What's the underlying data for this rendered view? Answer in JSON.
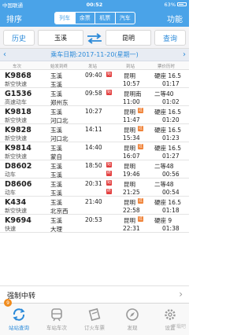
{
  "status": {
    "carrier": "中国联通",
    "time": "00:52",
    "battery": "63%"
  },
  "nav": {
    "left": "排序",
    "right": "功能",
    "segments": [
      "列车",
      "余票",
      "机票",
      "汽车"
    ],
    "active_segment": 0
  },
  "search": {
    "history": "历史",
    "from": "玉溪",
    "to": "昆明",
    "query": "查询"
  },
  "date": {
    "label": "乘车日期:2017-11-20(星期一)"
  },
  "headers": {
    "train": "车次",
    "origin": "始发到终",
    "depart": "发站",
    "arrive": "到站",
    "price": "票价历时"
  },
  "trains": [
    {
      "no": "K9868",
      "type": "新空快速",
      "from": "玉溪",
      "origin": "玉溪",
      "dep": "09:40",
      "fa": true,
      "zhong": false,
      "to": "昆明",
      "arr": "10:57",
      "guo": false,
      "price": "硬座 16.5",
      "dur": "01:17"
    },
    {
      "no": "G1536",
      "type": "高速动车",
      "from": "玉溪",
      "origin": "郑州东",
      "dep": "09:58",
      "fa": true,
      "zhong": false,
      "to": "昆明南",
      "arr": "11:00",
      "guo": false,
      "price": "二等40",
      "dur": "01:02"
    },
    {
      "no": "K9818",
      "type": "新空快速",
      "from": "玉溪",
      "origin": "河口北",
      "dep": "10:27",
      "fa": false,
      "zhong": false,
      "to": "昆明",
      "arr": "11:47",
      "guo": true,
      "price": "硬座 16.5",
      "dur": "01:20"
    },
    {
      "no": "K9828",
      "type": "新空快速",
      "from": "玉溪",
      "origin": "河口北",
      "dep": "14:11",
      "fa": false,
      "zhong": false,
      "to": "昆明",
      "arr": "15:34",
      "guo": true,
      "price": "硬座 16.5",
      "dur": "01:23"
    },
    {
      "no": "K9814",
      "type": "新空快速",
      "from": "玉溪",
      "origin": "蒙自",
      "dep": "14:40",
      "fa": false,
      "zhong": false,
      "to": "昆明",
      "arr": "16:07",
      "guo": true,
      "price": "硬座 16.5",
      "dur": "01:27"
    },
    {
      "no": "D8602",
      "type": "动车",
      "from": "玉溪",
      "origin": "玉溪",
      "dep": "18:50",
      "fa": true,
      "zhong": true,
      "to": "昆明",
      "arr": "19:46",
      "guo": false,
      "price": "二等48",
      "dur": "00:56"
    },
    {
      "no": "D8606",
      "type": "动车",
      "from": "玉溪",
      "origin": "玉溪",
      "dep": "20:31",
      "fa": true,
      "zhong": true,
      "to": "昆明",
      "arr": "21:25",
      "guo": false,
      "price": "二等48",
      "dur": "00:54"
    },
    {
      "no": "K434",
      "type": "新空快速",
      "from": "玉溪",
      "origin": "北京西",
      "dep": "21:40",
      "fa": false,
      "zhong": false,
      "to": "昆明",
      "arr": "22:58",
      "guo": true,
      "price": "硬座 16.5",
      "dur": "01:18"
    },
    {
      "no": "K9694",
      "type": "快速",
      "from": "玉溪",
      "origin": "大理",
      "dep": "20:53",
      "fa": false,
      "zhong": false,
      "to": "昆明",
      "arr": "22:31",
      "guo": true,
      "price": "硬座 9",
      "dur": "01:38"
    }
  ],
  "tags": {
    "fa": "始",
    "zhong": "终",
    "guo": "过"
  },
  "transfer": {
    "label": "强制中转"
  },
  "badge": "9",
  "tabs": [
    {
      "label": "站站查询",
      "icon": "refresh-icon"
    },
    {
      "label": "车站车次",
      "icon": "train-icon"
    },
    {
      "label": "订火车票",
      "icon": "ticket-icon"
    },
    {
      "label": "发现",
      "icon": "compass-icon"
    },
    {
      "label": "设置",
      "icon": "gear-icon"
    }
  ],
  "watermark": "下载吧"
}
